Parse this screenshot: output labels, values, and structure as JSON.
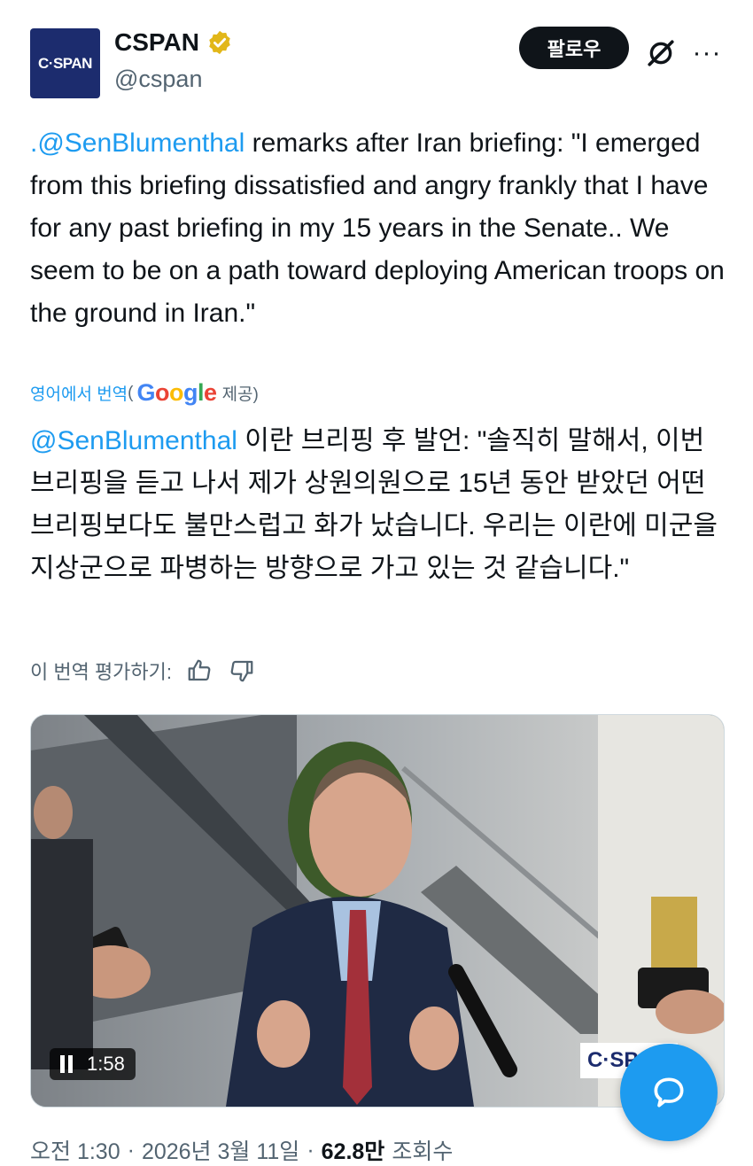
{
  "header": {
    "avatar_text": "C·SPAN",
    "display_name": "CSPAN",
    "handle": "@cspan",
    "follow_label": "팔로우",
    "more_label": "···",
    "verified_color": "#e2b719"
  },
  "tweet": {
    "mention": ".@SenBlumenthal",
    "text": " remarks after Iran briefing: \"I emerged from this briefing dissatisfied and angry frankly that I have for any past briefing in my 15 years in the Senate.. We seem to be on a path toward deploying American troops on the ground in Iran.\""
  },
  "translation": {
    "link_label": "영어에서 번역",
    "open_paren": "(",
    "provider": "Google",
    "provided_by": "제공)",
    "mention": "@SenBlumenthal",
    "text": " 이란 브리핑 후 발언: \"솔직히 말해서, 이번 브리핑을 듣고 나서 제가 상원의원으로 15년 동안 받았던 어떤 브리핑보다도 불만스럽고 화가 났습니다. 우리는 이란에 미군을 지상군으로 파병하는 방향으로 가고 있는 것 같습니다.\"",
    "rate_label": "이 번역 평가하기:"
  },
  "video": {
    "time": "1:58",
    "watermark": "C·SPAN"
  },
  "meta": {
    "time": "오전 1:30",
    "separator": "·",
    "date": "2026년 3월 11일",
    "views": "62.8만",
    "views_label": "조회수"
  },
  "colors": {
    "accent": "#1d9bf0",
    "brand": "#1c2c6e"
  }
}
